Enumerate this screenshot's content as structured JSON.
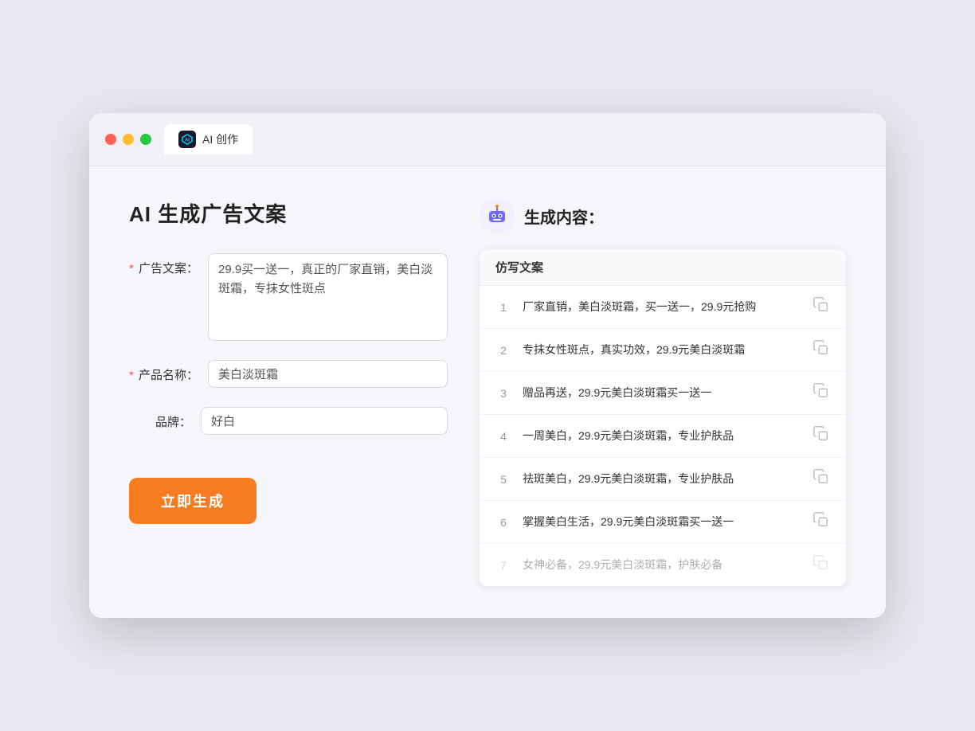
{
  "tab": {
    "label": "AI 创作"
  },
  "left_panel": {
    "title": "AI 生成广告文案",
    "fields": [
      {
        "id": "ad-copy",
        "label": "广告文案：",
        "required": true,
        "type": "textarea",
        "value": "29.9买一送一，真正的厂家直销，美白淡斑霜，专抹女性斑点"
      },
      {
        "id": "product-name",
        "label": "产品名称：",
        "required": true,
        "type": "input",
        "value": "美白淡斑霜"
      },
      {
        "id": "brand",
        "label": "品牌：",
        "required": false,
        "type": "input",
        "value": "好白"
      }
    ],
    "button_label": "立即生成"
  },
  "right_panel": {
    "title": "生成内容：",
    "table_header": "仿写文案",
    "results": [
      {
        "index": 1,
        "text": "厂家直销，美白淡斑霜，买一送一，29.9元抢购",
        "faded": false
      },
      {
        "index": 2,
        "text": "专抹女性斑点，真实功效，29.9元美白淡斑霜",
        "faded": false
      },
      {
        "index": 3,
        "text": "赠品再送，29.9元美白淡斑霜买一送一",
        "faded": false
      },
      {
        "index": 4,
        "text": "一周美白，29.9元美白淡斑霜，专业护肤品",
        "faded": false
      },
      {
        "index": 5,
        "text": "祛斑美白，29.9元美白淡斑霜，专业护肤品",
        "faded": false
      },
      {
        "index": 6,
        "text": "掌握美白生活，29.9元美白淡斑霜买一送一",
        "faded": false
      },
      {
        "index": 7,
        "text": "女神必备，29.9元美白淡斑霜，护肤必备",
        "faded": true
      }
    ]
  }
}
